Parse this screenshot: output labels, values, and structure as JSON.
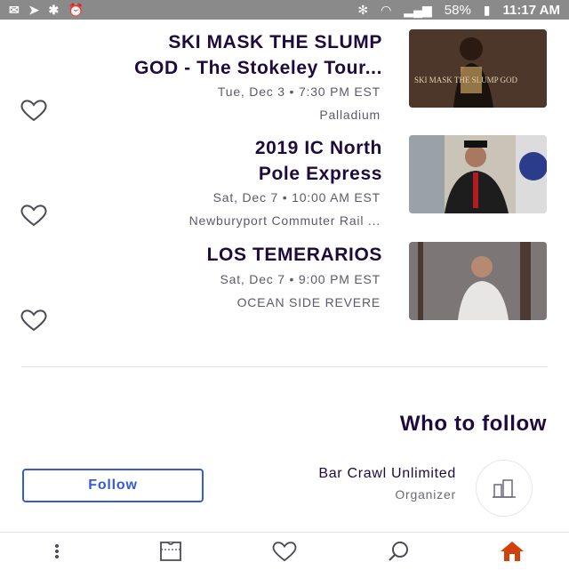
{
  "status_bar": {
    "time": "11:17 AM",
    "battery": "58%",
    "icons": [
      "bluetooth-icon",
      "wifi-icon",
      "signal-icon",
      "battery-icon",
      "fan-icon",
      "alarm-icon",
      "vibrate-icon",
      "location-icon",
      "mail-icon"
    ]
  },
  "events": [
    {
      "title_line1": "SKI MASK THE SLUMP",
      "title_line2": "GOD - The Stokeley Tour...",
      "date": "Tue, Dec 3 • 7:30 PM EST",
      "venue": "Palladium",
      "thumb_text": "SKI MASK THE SLUMP GOD"
    },
    {
      "title_line1": "2019 IC North",
      "title_line2": "Pole Express",
      "date": "Sat, Dec 7 • 10:00 AM EST",
      "venue": "Newburyport Commuter Rail ...",
      "thumb_text": ""
    },
    {
      "title_line1": "LOS TEMERARIOS",
      "title_line2": "",
      "date": "Sat, Dec 7 • 9:00 PM EST",
      "venue": "OCEAN SIDE REVERE",
      "thumb_text": ""
    }
  ],
  "who_to_follow": {
    "title": "Who to follow",
    "organizer_name": "Bar Crawl Unlimited",
    "organizer_role": "Organizer",
    "follow_label": "Follow"
  },
  "tabs": [
    "home-icon",
    "search-icon",
    "heart-icon",
    "ticket-icon",
    "more-icon"
  ],
  "colors": {
    "accent": "#3659e3",
    "home_active": "#d1410c",
    "title": "#1e0a3c"
  }
}
